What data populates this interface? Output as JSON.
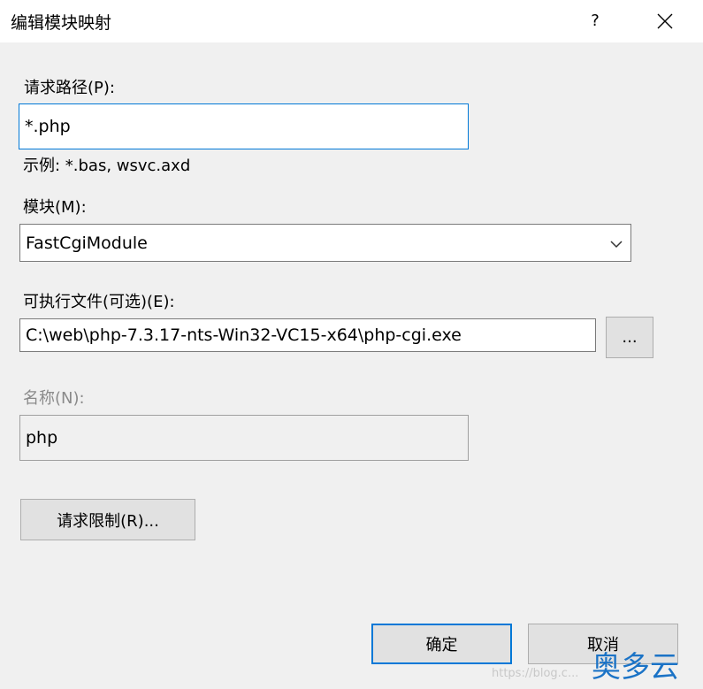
{
  "window": {
    "title": "编辑模块映射",
    "help_label": "?"
  },
  "request_path": {
    "label": "请求路径(P):",
    "value": "*.php",
    "example": "示例: *.bas, wsvc.axd"
  },
  "module": {
    "label": "模块(M):",
    "value": "FastCgiModule"
  },
  "executable": {
    "label": "可执行文件(可选)(E):",
    "value": "C:\\web\\php-7.3.17-nts-Win32-VC15-x64\\php-cgi.exe",
    "browse_label": "..."
  },
  "name": {
    "label": "名称(N):",
    "value": "php"
  },
  "restrictions_button": "请求限制(R)...",
  "ok_button": "确定",
  "cancel_button": "取消",
  "watermark": {
    "text": "奥多云",
    "url": "https://blog.c..."
  },
  "colors": {
    "accent": "#0078d7",
    "watermark": "#1b73c6"
  }
}
